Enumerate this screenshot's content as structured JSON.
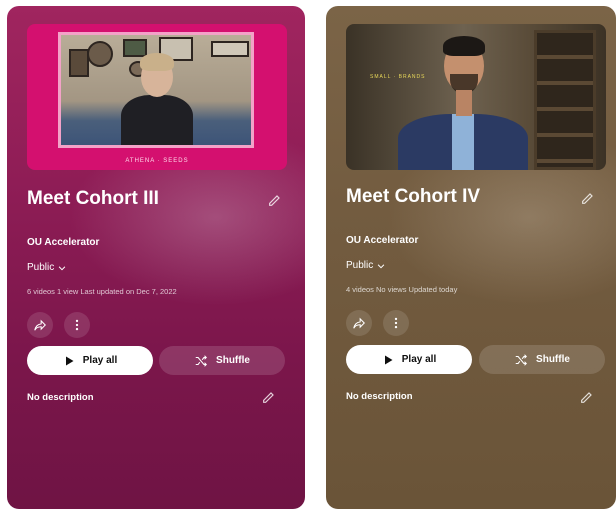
{
  "playlists": [
    {
      "title": "Meet Cohort III",
      "owner": "OU Accelerator",
      "privacy": "Public",
      "stats": "6 videos  1 view  Last updated on Dec 7, 2022",
      "play_label": "Play all",
      "shuffle_label": "Shuffle",
      "description": "No description",
      "thumb_logo": "ATHENA · SEEDS"
    },
    {
      "title": "Meet Cohort IV",
      "owner": "OU Accelerator",
      "privacy": "Public",
      "stats": "4 videos  No views  Updated today",
      "play_label": "Play all",
      "shuffle_label": "Shuffle",
      "description": "No description",
      "thumb_wall_label": "SMALL · BRANDS"
    }
  ],
  "colors": {
    "card1_bg": "#8f1d56",
    "card2_bg": "#735c40",
    "thumb1_frame": "#d4106f",
    "play_button_bg": "#ffffff"
  },
  "icons": [
    "pencil-icon",
    "chevron-down-icon",
    "share-icon",
    "more-vert-icon",
    "play-icon",
    "shuffle-icon"
  ]
}
